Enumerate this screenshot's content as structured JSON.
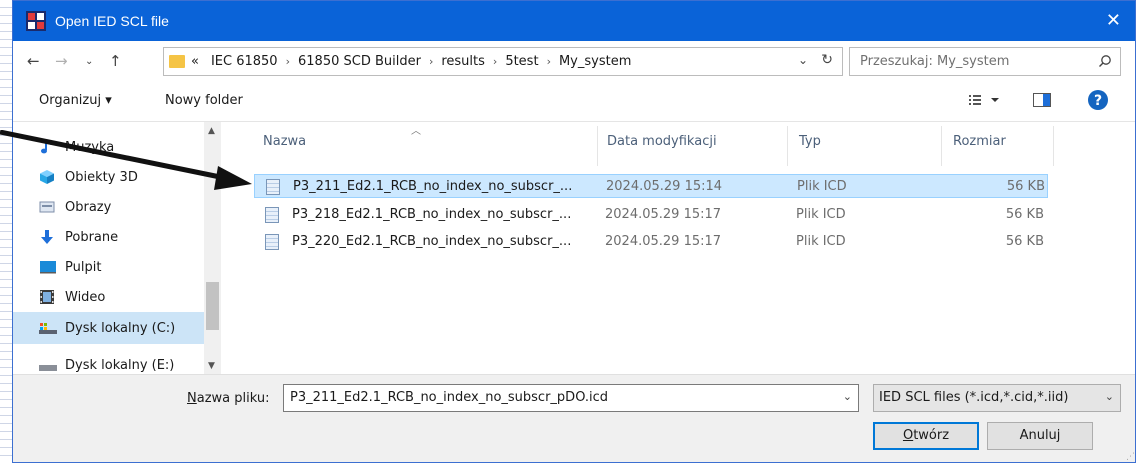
{
  "window": {
    "title": "Open IED SCL file"
  },
  "address": {
    "overflow": "«",
    "crumbs": [
      "IEC 61850",
      "61850 SCD Builder",
      "results",
      "5test",
      "My_system"
    ]
  },
  "search": {
    "placeholder": "Przeszukaj: My_system"
  },
  "toolbar": {
    "organize": "Organizuj ▾",
    "new_folder": "Nowy folder"
  },
  "navpane": {
    "items": [
      "Muzyka",
      "Obiekty 3D",
      "Obrazy",
      "Pobrane",
      "Pulpit",
      "Wideo",
      "Dysk lokalny (C:)",
      "Dysk lokalny (E:)"
    ]
  },
  "columns": {
    "name": "Nazwa",
    "date": "Data modyfikacji",
    "type": "Typ",
    "size": "Rozmiar"
  },
  "files": [
    {
      "name": "P3_211_Ed2.1_RCB_no_index_no_subscr_...",
      "date": "2024.05.29 15:14",
      "type": "Plik ICD",
      "size": "56 KB"
    },
    {
      "name": "P3_218_Ed2.1_RCB_no_index_no_subscr_...",
      "date": "2024.05.29 15:17",
      "type": "Plik ICD",
      "size": "56 KB"
    },
    {
      "name": "P3_220_Ed2.1_RCB_no_index_no_subscr_...",
      "date": "2024.05.29 15:17",
      "type": "Plik ICD",
      "size": "56 KB"
    }
  ],
  "footer": {
    "filename_label_accel": "N",
    "filename_label_rest": "azwa pliku:",
    "filename_value": "P3_211_Ed2.1_RCB_no_index_no_subscr_pDO.icd",
    "filter": "IED SCL files (*.icd,*.cid,*.iid)",
    "open_accel": "O",
    "open_rest": "twórz",
    "cancel": "Anuluj"
  },
  "colors": {
    "titlebar": "#0a63d8",
    "selection": "#cce8ff",
    "accent": "#0078d7"
  }
}
